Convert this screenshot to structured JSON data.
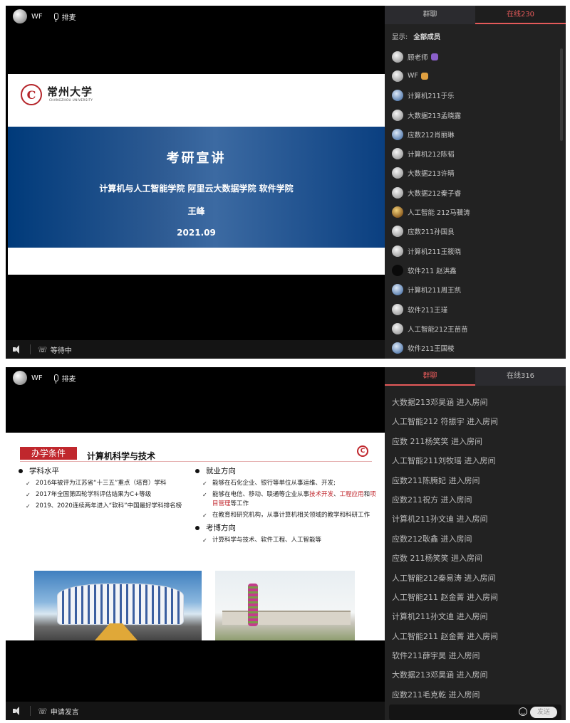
{
  "panel1": {
    "topbar": {
      "user_name": "WF",
      "mic_label": "排麦"
    },
    "slide": {
      "university_name": "常州大学",
      "university_en": "CHANGZHOU UNIVERSITY",
      "title": "考研宣讲",
      "subtitle": "计算机与人工智能学院  阿里云大数据学院  软件学院",
      "author": "王峰",
      "date": "2021.09"
    },
    "bottombar": {
      "status_label": "等待中"
    },
    "chat": {
      "tab_group": "群聊",
      "tab_online": "在线230",
      "active_tab": "online",
      "show_label": "显示:",
      "show_value": "全部成员",
      "members": [
        {
          "name": "顾老师",
          "avatar": "photo-avatar",
          "role": "teacher-icon"
        },
        {
          "name": "WF",
          "avatar": "ball-avatar",
          "role": "assistant-icon"
        },
        {
          "name": "计算机211于乐",
          "avatar": "blue-avatar"
        },
        {
          "name": "大数据213孟晓露",
          "avatar": "photo-avatar"
        },
        {
          "name": "应数212肖丽琳",
          "avatar": "blue-avatar"
        },
        {
          "name": "计算机212陈韬",
          "avatar": "photo-avatar"
        },
        {
          "name": "大数据213许晴",
          "avatar": "photo-avatar"
        },
        {
          "name": "大数据212秦子睿",
          "avatar": "photo-avatar"
        },
        {
          "name": "人工智能 212马骥涛",
          "avatar": "warm-avatar"
        },
        {
          "name": "应数211孙国良",
          "avatar": "photo-avatar"
        },
        {
          "name": "计算机211王筱晓",
          "avatar": "photo-avatar"
        },
        {
          "name": "软件211 赵洪鑫",
          "avatar": "dark-avatar"
        },
        {
          "name": "计算机211周王凯",
          "avatar": "blue-avatar"
        },
        {
          "name": "软件211王瑾",
          "avatar": "photo-avatar"
        },
        {
          "name": "人工智能212王苗苗",
          "avatar": "photo-avatar"
        },
        {
          "name": "软件211王国棱",
          "avatar": "blue-avatar"
        }
      ]
    }
  },
  "panel2": {
    "topbar": {
      "user_name": "WF",
      "mic_label": "排麦"
    },
    "slide": {
      "tag": "办学条件",
      "title": "计算机科学与技术",
      "left_heading": "学科水平",
      "left_items": [
        "2016年被评为江苏省“十三五”重点（培育）学科",
        "2017年全国第四轮学科评估结果为C+等级",
        "2019、2020连续两年进入“软科”中国最好学科排名榜"
      ],
      "right_heading1": "就业方向",
      "right_item1": "能够在石化企业、银行等单位从事运维、开发;",
      "right_item2_pre": "能够在电信、移动、联通等企业从事",
      "right_item2_red1": "技术开发",
      "right_item2_sep": "、",
      "right_item2_red2": "工程应用",
      "right_item2_and": "和",
      "right_item2_red3": "项目管理",
      "right_item2_post": "等工作",
      "right_item3": "在教育和研究机构，从事计算机相关领域的教学和科研工作",
      "right_heading2": "考博方向",
      "right_item4": "计算科学与技术、软件工程、人工智能等"
    },
    "bottombar": {
      "status_label": "申请发言"
    },
    "chat": {
      "tab_group": "群聊",
      "tab_online": "在线316",
      "active_tab": "group",
      "messages": [
        "大数据213邓昊涵 进入房间",
        "人工智能212 符振宇 进入房间",
        "应数 211杨笑笑 进入房间",
        "人工智能211刘牧瑶 进入房间",
        "应数211陈腾妃 进入房间",
        "应数211祝方 进入房间",
        "计算机211孙文迪 进入房间",
        "应数212耿鑫 进入房间",
        "应数 211杨笑笑 进入房间",
        "人工智能212秦易涛 进入房间",
        "人工智能211 赵金菁 进入房间",
        "计算机211孙文迪 进入房间",
        "人工智能211 赵金菁 进入房间",
        "软件211薛宇昊 进入房间",
        "大数据213邓昊涵 进入房间",
        "应数211毛克乾 进入房间"
      ],
      "send_label": "发送"
    }
  }
}
